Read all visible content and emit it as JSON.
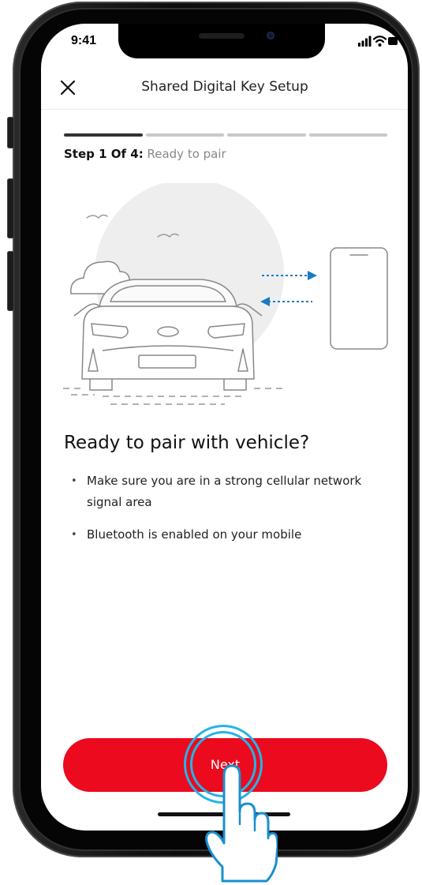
{
  "status_bar": {
    "time": "9:41",
    "icons": [
      "cellular-signal-icon",
      "wifi-icon",
      "battery-icon"
    ]
  },
  "header": {
    "close_icon": "close-icon",
    "title": "Shared Digital Key Setup"
  },
  "progress": {
    "total_steps": 4,
    "current_step": 1,
    "step_prefix": "Step 1 Of 4:",
    "step_name": "Ready to pair"
  },
  "illustration": {
    "icons": [
      "car-icon",
      "phone-icon",
      "cloud-icon",
      "bird-icon",
      "arrow-right-icon",
      "arrow-left-icon"
    ]
  },
  "content": {
    "heading": "Ready to pair with vehicle?",
    "bullets": [
      "Make sure you are in a strong cellular network signal area",
      "Bluetooth is enabled on your mobile"
    ]
  },
  "actions": {
    "next_label": "Next"
  },
  "colors": {
    "primary": "#eb0a1e",
    "tap_highlight": "#23b4e8",
    "arrow_blue": "#1a7bc4"
  }
}
